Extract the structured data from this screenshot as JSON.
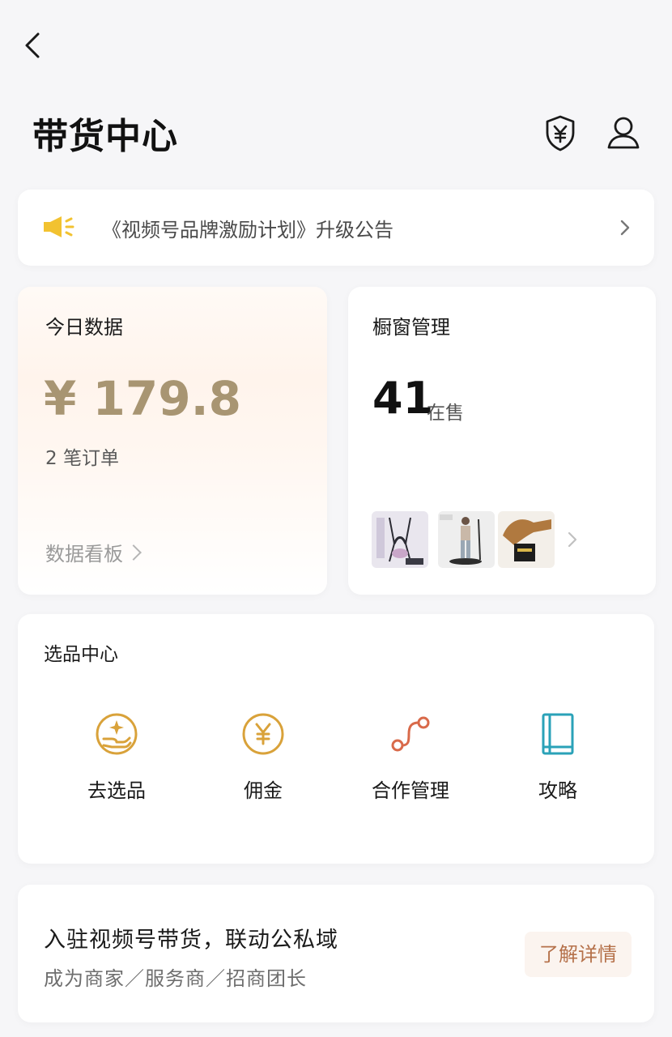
{
  "header": {
    "title": "带货中心",
    "back_icon": "chevron-left-icon",
    "shield_icon": "shield-yen-icon",
    "user_icon": "user-icon"
  },
  "notice": {
    "icon": "megaphone-icon",
    "text": "《视频号品牌激励计划》升级公告",
    "chevron": "chevron-right-icon"
  },
  "today": {
    "title": "今日数据",
    "amount": "¥ 179.8",
    "orders": "2 笔订单",
    "link": "数据看板"
  },
  "window": {
    "title": "橱窗管理",
    "count": "41",
    "unit": "在售"
  },
  "select_center": {
    "title": "选品中心",
    "items": [
      {
        "label": "去选品",
        "icon": "hand-star-icon"
      },
      {
        "label": "佣金",
        "icon": "yen-coin-icon"
      },
      {
        "label": "合作管理",
        "icon": "connection-icon"
      },
      {
        "label": "攻略",
        "icon": "book-icon"
      }
    ]
  },
  "promo": {
    "title": "入驻视频号带货，联动公私域",
    "subtitle": "成为商家／服务商／招商团长",
    "button": "了解详情"
  },
  "colors": {
    "gold": "#a89572",
    "accent_orange": "#b5714a",
    "teal": "#2aa2b8",
    "megaphone_yellow": "#f2c230"
  }
}
